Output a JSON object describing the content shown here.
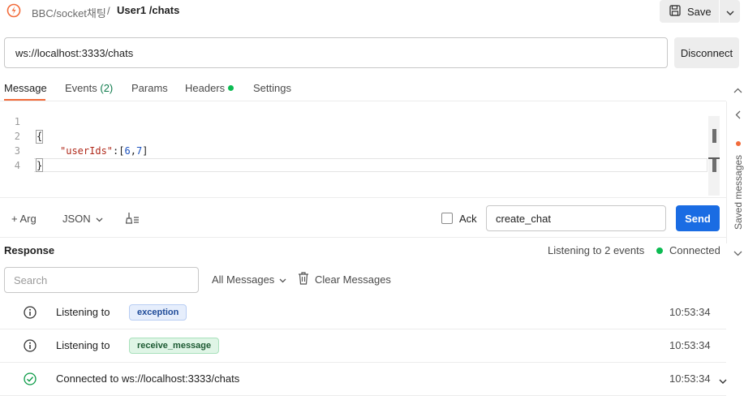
{
  "header": {
    "breadcrumb_parent": "BBC/socket채팅",
    "breadcrumb_sep": "/",
    "breadcrumb_current": "User1 /chats",
    "save_label": "Save"
  },
  "connection": {
    "url": "ws://localhost:3333/chats",
    "disconnect_label": "Disconnect"
  },
  "tabs": {
    "message": "Message",
    "events": "Events",
    "events_count": "(2)",
    "params": "Params",
    "headers": "Headers",
    "settings": "Settings"
  },
  "editor": {
    "line_numbers": [
      "1",
      "2",
      "3",
      "4"
    ],
    "open_brace": "{",
    "key": "\"userIds\"",
    "colon": ":",
    "value_open": "[",
    "value_a": "6",
    "comma": ",",
    "value_b": "7",
    "value_close": "]",
    "close_brace": "}"
  },
  "composer": {
    "arg_label": "+ Arg",
    "format_label": "JSON",
    "ack_label": "Ack",
    "event_name": "create_chat",
    "send_label": "Send"
  },
  "response": {
    "title": "Response",
    "listening_count": "Listening to 2 events",
    "status": "Connected",
    "search_placeholder": "Search",
    "filter_label": "All Messages",
    "clear_label": "Clear Messages",
    "rows": [
      {
        "text": "Listening to",
        "badge": "exception",
        "time": "10:53:34"
      },
      {
        "text": "Listening to",
        "badge": "receive_message",
        "time": "10:53:34"
      },
      {
        "text": "Connected to ws://localhost:3333/chats",
        "time": "10:53:34"
      }
    ]
  },
  "side_panel": {
    "label": "Saved messages"
  },
  "colors": {
    "accent": "#f26b3a",
    "primary": "#1a6ce3",
    "connected": "#0cbb52"
  },
  "icons": [
    "postman-logo-icon",
    "save-icon",
    "chevron-down-icon",
    "chevron-up-icon",
    "chevron-left-icon",
    "plus-icon",
    "beautify-icon",
    "trash-icon",
    "info-icon",
    "check-circle-icon"
  ]
}
